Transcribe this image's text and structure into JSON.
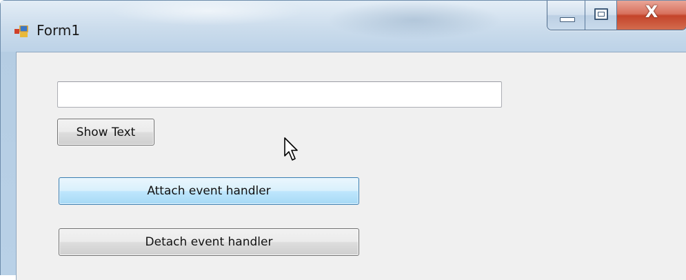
{
  "window": {
    "title": "Form1",
    "icon": "winforms-app-icon",
    "controls": {
      "minimize_icon": "minimize-icon",
      "maximize_icon": "maximize-icon",
      "close_glyph": "X"
    }
  },
  "form": {
    "text_input": {
      "value": "",
      "placeholder": ""
    },
    "show_text_label": "Show Text",
    "attach_label": "Attach event handler",
    "detach_label": "Detach event handler"
  },
  "colors": {
    "client_background": "#f0f0f0",
    "hover_button": "#bee6fd",
    "close_button": "#c4442a"
  },
  "pointer": "mouse-cursor-icon"
}
